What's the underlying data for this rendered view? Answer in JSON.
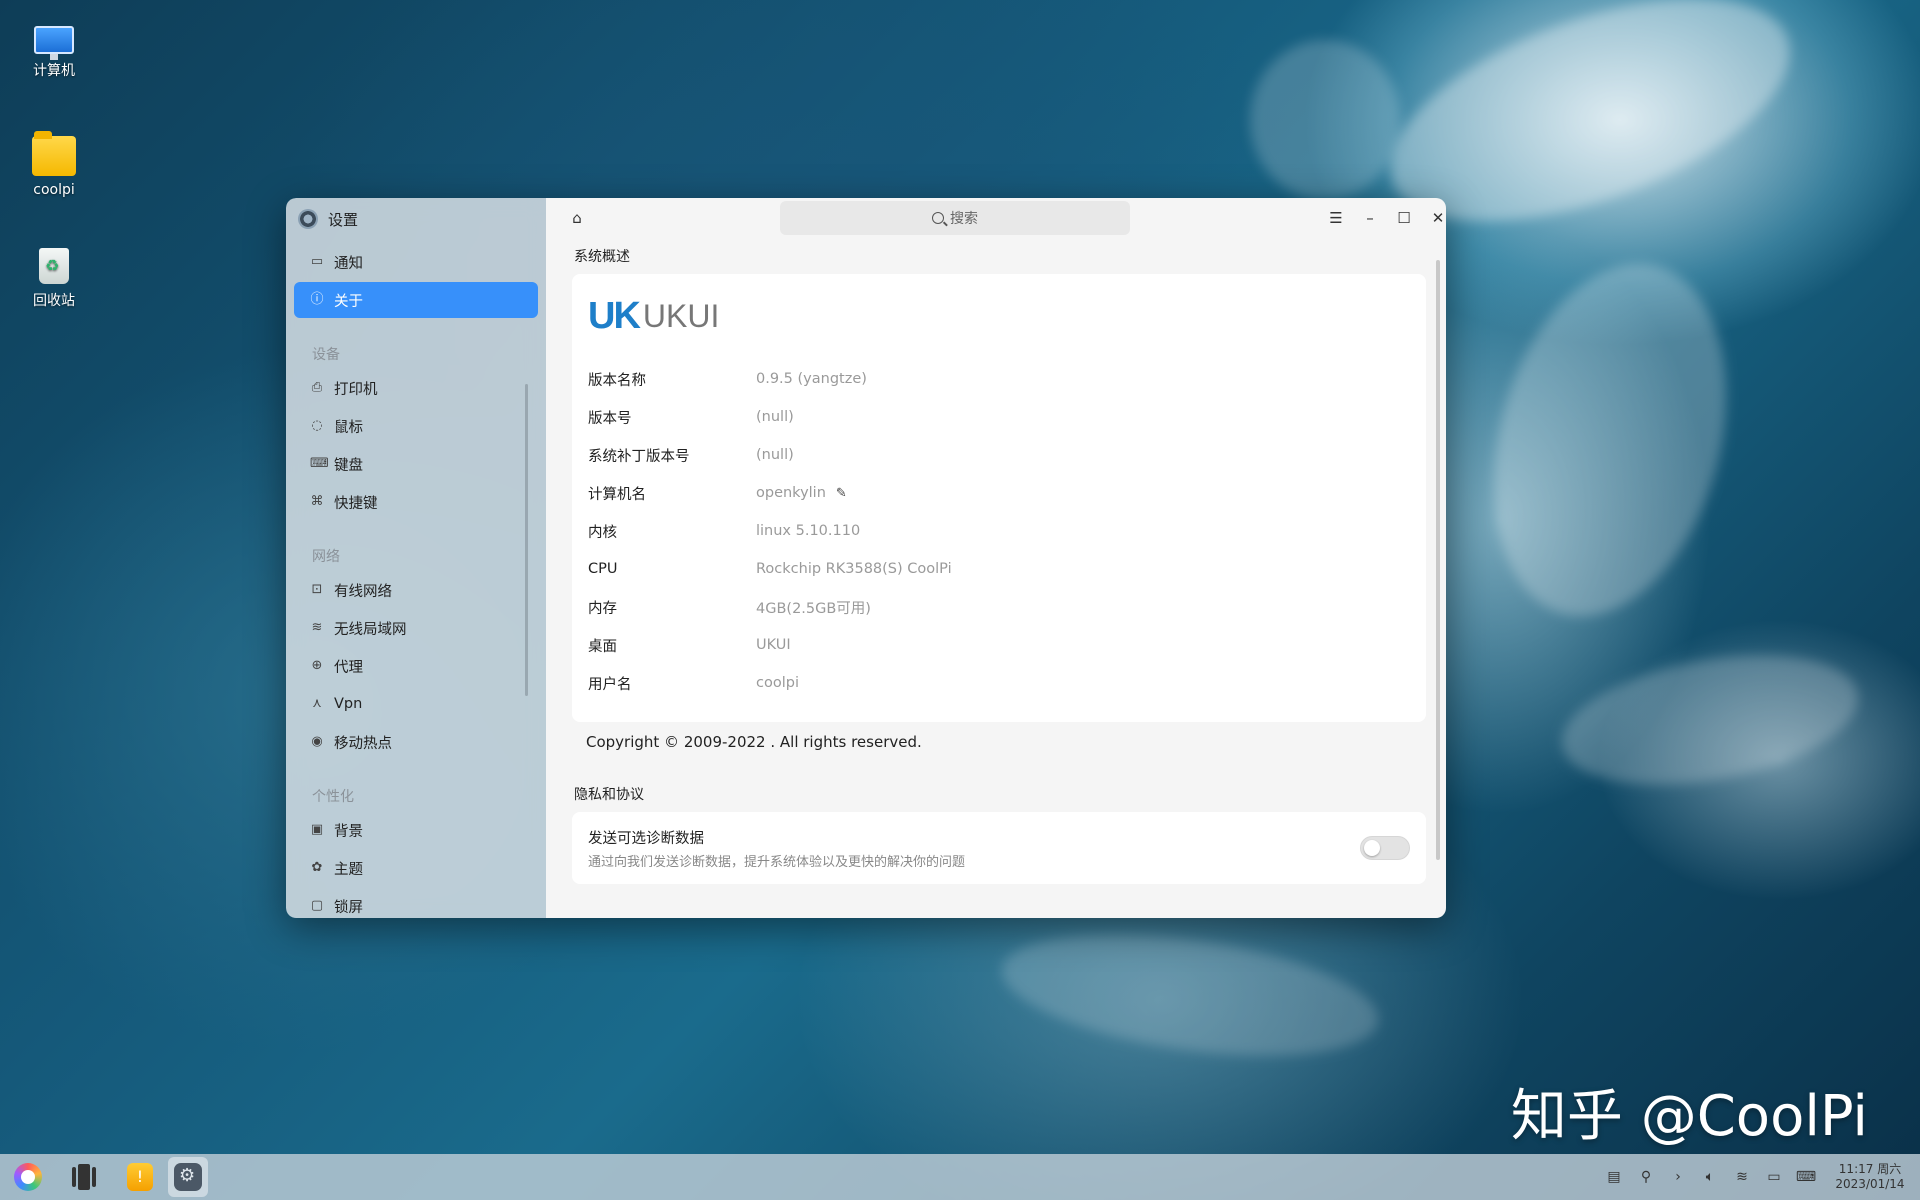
{
  "desktop": {
    "icons": [
      {
        "label": "计算机"
      },
      {
        "label": "coolpi"
      },
      {
        "label": "回收站"
      }
    ]
  },
  "window": {
    "app_title": "设置",
    "search_placeholder": "搜索",
    "sidebar": {
      "items_top": [
        {
          "label": "通知",
          "icon": "message-icon"
        },
        {
          "label": "关于",
          "icon": "info-icon",
          "active": true
        }
      ],
      "groups": [
        {
          "title": "设备",
          "items": [
            {
              "label": "打印机",
              "icon": "printer-icon"
            },
            {
              "label": "鼠标",
              "icon": "mouse-icon"
            },
            {
              "label": "键盘",
              "icon": "keyboard-icon"
            },
            {
              "label": "快捷键",
              "icon": "shortcut-icon"
            }
          ]
        },
        {
          "title": "网络",
          "items": [
            {
              "label": "有线网络",
              "icon": "wired-network-icon"
            },
            {
              "label": "无线局域网",
              "icon": "wifi-icon"
            },
            {
              "label": "代理",
              "icon": "proxy-icon"
            },
            {
              "label": "Vpn",
              "icon": "vpn-icon"
            },
            {
              "label": "移动热点",
              "icon": "hotspot-icon"
            }
          ]
        },
        {
          "title": "个性化",
          "items": [
            {
              "label": "背景",
              "icon": "image-icon"
            },
            {
              "label": "主题",
              "icon": "palette-icon"
            },
            {
              "label": "锁屏",
              "icon": "lockscreen-icon"
            }
          ]
        }
      ]
    },
    "about": {
      "section_title": "系统概述",
      "logo": {
        "mark": "UK",
        "text": "UKUI"
      },
      "rows": [
        {
          "key": "版本名称",
          "value": "0.9.5 (yangtze)"
        },
        {
          "key": "版本号",
          "value": "(null)"
        },
        {
          "key": "系统补丁版本号",
          "value": "(null)"
        },
        {
          "key": "计算机名",
          "value": "openkylin",
          "editable": true
        },
        {
          "key": "内核",
          "value": "linux 5.10.110"
        },
        {
          "key": "CPU",
          "value": "Rockchip RK3588(S) CoolPi"
        },
        {
          "key": "内存",
          "value": "4GB(2.5GB可用)"
        },
        {
          "key": "桌面",
          "value": "UKUI"
        },
        {
          "key": "用户名",
          "value": "coolpi"
        }
      ],
      "copyright": "Copyright © 2009-2022 . All rights reserved."
    },
    "privacy": {
      "section_title": "隐私和协议",
      "title": "发送可选诊断数据",
      "description": "通过向我们发送诊断数据，提升系统体验以及更快的解决你的问题",
      "toggle_on": false
    }
  },
  "watermark": "知乎 @CoolPi",
  "taskbar": {
    "clock_time": "11:17 周六",
    "clock_date": "2023/01/14"
  },
  "colors": {
    "accent": "#3790fa",
    "uk_blue": "#1e7fc9"
  }
}
